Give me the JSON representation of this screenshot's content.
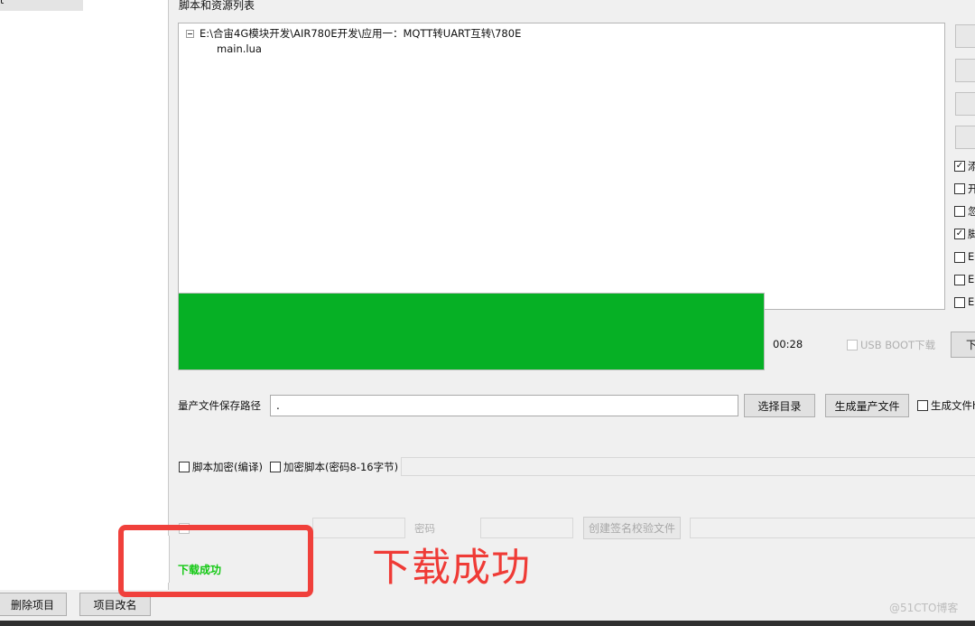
{
  "left_panel": {
    "delete_button": "删除项目",
    "rename_button": "项目改名"
  },
  "script_list": {
    "label": "脚本和资源列表",
    "root_path": "E:\\合宙4G模块开发\\AIR780E开发\\应用一：MQTT转UART互转\\780E",
    "files": [
      "main.lua"
    ]
  },
  "options": {
    "checkbox_1_checked": true,
    "checkbox_4_checked": true
  },
  "progress": {
    "percent": 100,
    "time": "00:28",
    "usb_boot_label": "USB BOOT下载",
    "download_button_partial": "下"
  },
  "mass_production": {
    "label": "量产文件保存路径",
    "path_value": ".",
    "choose_dir_button": "选择目录",
    "generate_button": "生成量产文件",
    "generate_checkbox_label": "生成文件h"
  },
  "encryption": {
    "compile_label": "脚本加密(编译)",
    "encrypt_label": "加密脚本(密码8-16字节)",
    "password_label": "密码",
    "create_sign_button": "创建签名校验文件"
  },
  "status": {
    "text": "下载成功",
    "annotation": "下载成功",
    "annotation_color": "#ef3b36"
  },
  "watermark": "@51CTO博客"
}
